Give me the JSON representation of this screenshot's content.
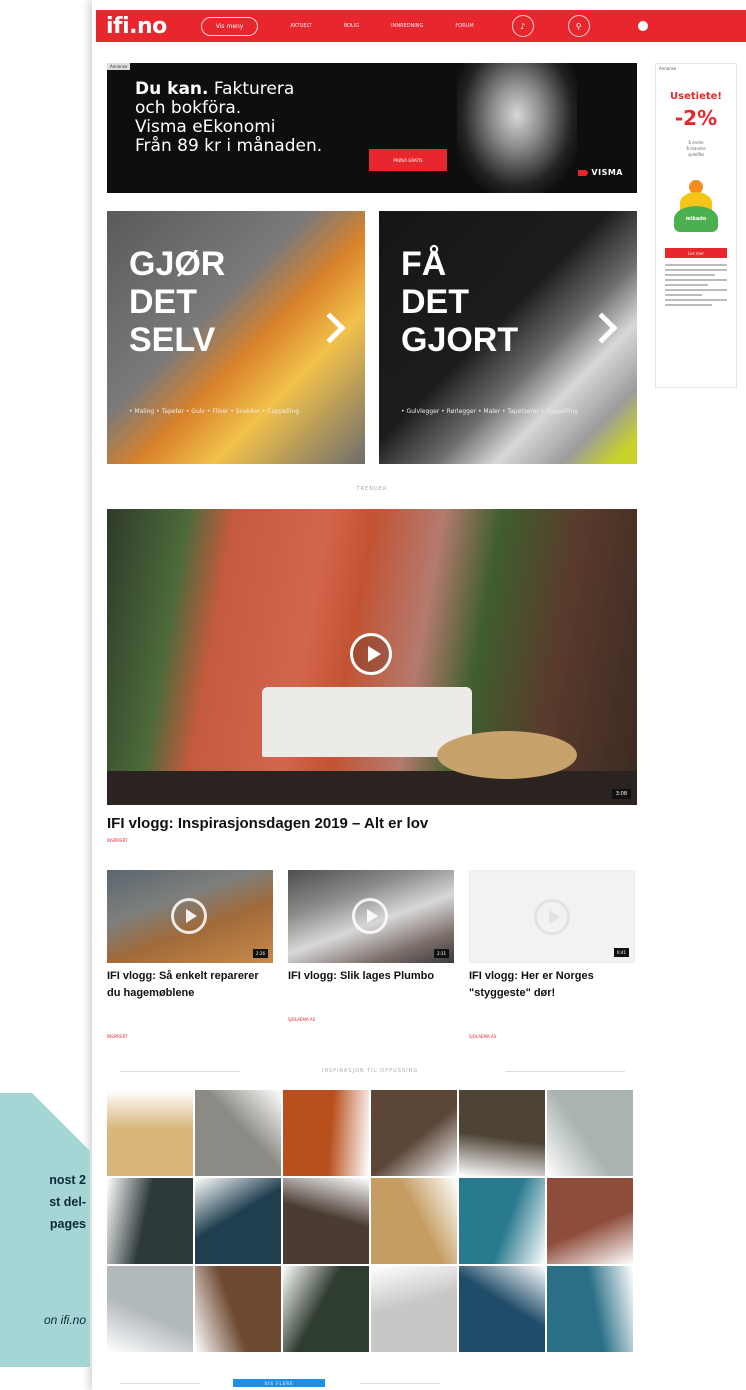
{
  "header": {
    "logo": "ifi.no",
    "menu_pill": "Vis meny",
    "nav": [
      "AKTUELT",
      "BOLIG",
      "INNREDNING",
      "FORUM"
    ]
  },
  "ad_banner": {
    "tag": "Annonse",
    "line1_bold": "Du kan.",
    "line1_rest": " Fakturera",
    "line2": "och bokföra.",
    "line3": "Visma eEkonomi",
    "line4": "Från 89 kr i månaden.",
    "cta": "PRØVA GRATIS",
    "brand": "VISMA"
  },
  "side_ad": {
    "tag": "Annonse",
    "title": "Usetiete!",
    "percent": "-2%",
    "subtitle": "å endre\nå mandre\nspleiflte",
    "logo_label": "mikado",
    "button": "Les mer"
  },
  "tiles": [
    {
      "title_lines": [
        "GJØR",
        "DET",
        "SELV"
      ],
      "links": "• Maling • Tapeter • Gulv • Fliser • Snekker • Cappelling"
    },
    {
      "title_lines": [
        "FÅ",
        "DET",
        "GJORT"
      ],
      "links": "• Gulvlegger • Rørlegger • Maler • Tapetserer • Cappelling"
    }
  ],
  "section_trend": "TRENDER",
  "feature": {
    "title": "IFI vlogg: Inspirasjonsdagen 2019 – Alt er lov",
    "duration": "3:08",
    "tag": "INSPIRERT"
  },
  "videos": [
    {
      "title": "IFI vlogg: Så enkelt reparerer du hagemøblene",
      "duration": "2:26",
      "tag": "INSPIRERT"
    },
    {
      "title": "IFI vlogg: Slik lages Plumbo",
      "duration": "2:31",
      "tag": "SJOLAEMA AS"
    },
    {
      "title": "IFI vlogg: Her er Norges \"styggeste\" dør!",
      "duration": "0:41",
      "tag": "SJOLAEMA AS"
    }
  ],
  "section_inspiration": "INSPIRASJON TIL OPPUSSING",
  "grid_colors": [
    "#d9b77c",
    "#8c8a84",
    "#b8501e",
    "#5c4638",
    "#4e4436",
    "#a9b3b2",
    "#2e3a3a",
    "#1f3f4f",
    "#4a3c33",
    "#c59d62",
    "#2a7a8e",
    "#8e4c3a",
    "#b2b9bc",
    "#6e4a32",
    "#2f3c30",
    "#c7c7c5",
    "#1f4c68",
    "#2a6f86"
  ],
  "bottom_button": "VIS FLERE",
  "callout": {
    "line1": "nost 2",
    "line2": "st del-",
    "line3": "pages",
    "sub": "on ifi.no"
  }
}
